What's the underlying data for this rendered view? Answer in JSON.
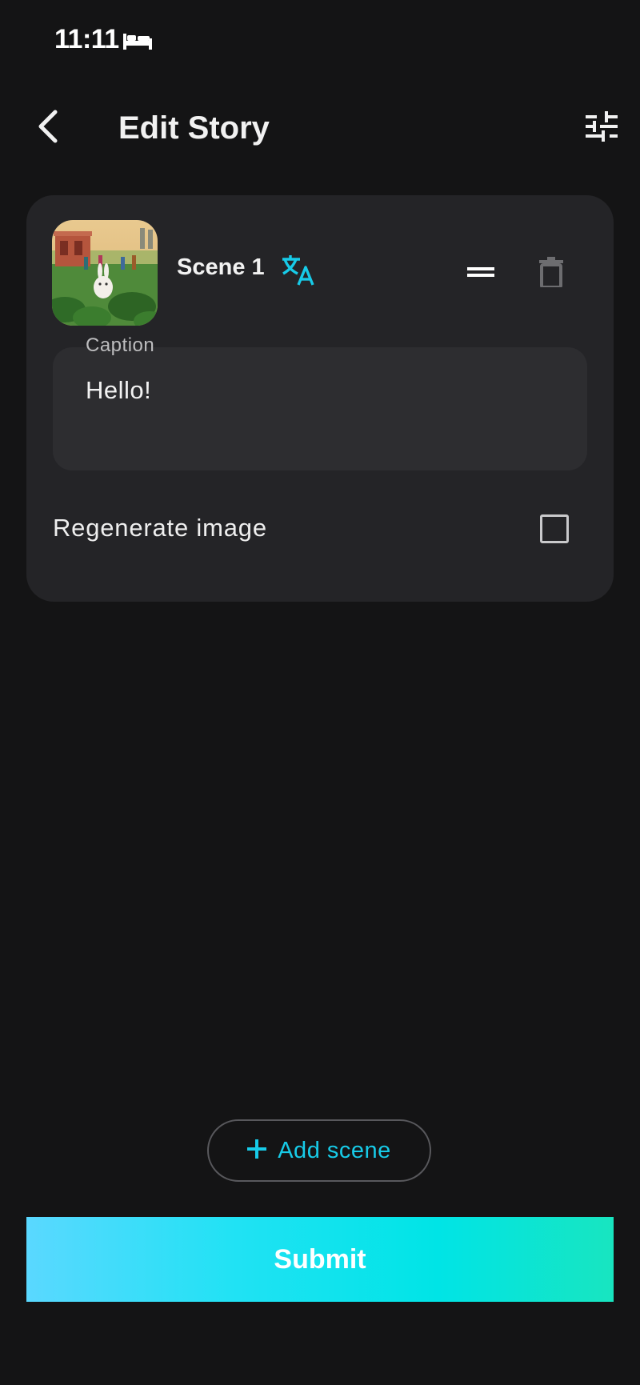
{
  "status_bar": {
    "time": "11:11",
    "icon": "bed-icon"
  },
  "header": {
    "title": "Edit Story",
    "back_icon": "chevron-left-icon",
    "settings_icon": "sliders-icon"
  },
  "scenes": [
    {
      "label": "Scene 1",
      "thumbnail_icon": "scene-image",
      "caption_label": "Caption",
      "caption_value": "Hello!",
      "regenerate_label": "Regenerate image",
      "regenerate_checked": false
    }
  ],
  "actions": {
    "add_scene_label": "Add scene",
    "submit_label": "Submit"
  },
  "colors": {
    "background": "#141415",
    "card": "#242427",
    "field": "#2d2d30",
    "accent": "#17cbe8",
    "submit_gradient_start": "#5ad8ff",
    "submit_gradient_end": "#18e5c0"
  }
}
